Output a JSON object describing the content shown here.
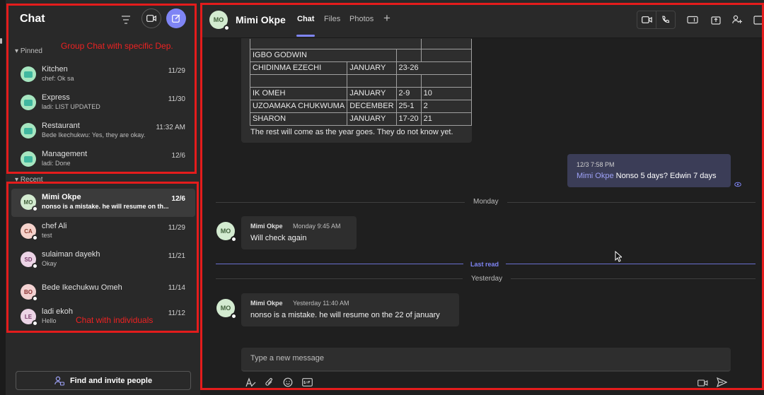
{
  "left": {
    "title": "Chat",
    "pinned_label": "Pinned",
    "recent_label": "Recent",
    "pinned": [
      {
        "name": "Kitchen",
        "preview": "chef: Ok sa",
        "time": "11/29"
      },
      {
        "name": "Express",
        "preview": "ladi: LIST UPDATED",
        "time": "11/30"
      },
      {
        "name": "Restaurant",
        "preview": "Bede Ikechukwu: Yes, they are okay.",
        "time": "11:32 AM"
      },
      {
        "name": "Management",
        "preview": "ladi: Done",
        "time": "12/6"
      }
    ],
    "recent": [
      {
        "initials": "MO",
        "name": "Mimi Okpe",
        "preview": "nonso is a mistake. he will resume on th...",
        "time": "12/6"
      },
      {
        "initials": "CA",
        "name": "chef Ali",
        "preview": "test",
        "time": "11/29"
      },
      {
        "initials": "SD",
        "name": "sulaiman dayekh",
        "preview": "Okay",
        "time": "11/21"
      },
      {
        "initials": "BO",
        "name": "Bede Ikechukwu Omeh",
        "preview": "",
        "time": "11/14"
      },
      {
        "initials": "LE",
        "name": "ladi ekoh",
        "preview": "Hello",
        "time": "11/12"
      }
    ],
    "invite_label": "Find and invite people"
  },
  "annotations": {
    "group": "Group Chat with specific Dep.",
    "individual": "Chat with individuals"
  },
  "header": {
    "initials": "MO",
    "name": "Mimi Okpe",
    "tabs": [
      "Chat",
      "Files",
      "Photos"
    ],
    "add_tab": "+"
  },
  "messages": {
    "table_rows": [
      [
        "IGBO GODWIN",
        "",
        "",
        ""
      ],
      [
        "CHIDINMA EZECHI",
        "JANUARY",
        "23-26",
        ""
      ],
      [
        "IK OMEH",
        "JANUARY",
        "2-9",
        "10"
      ],
      [
        "UZOAMAKA CHUKWUMA",
        "DECEMBER",
        "25-1",
        "2"
      ],
      [
        "SHARON",
        "JANUARY",
        "17-20",
        "21"
      ]
    ],
    "table_footer": "The rest will come as the year goes. They do not know yet.",
    "mine": {
      "time": "12/3 7:58 PM",
      "mention": "Mimi Okpe",
      "text": "Nonso 5 days? Edwin 7 days"
    },
    "divider_monday": "Monday",
    "msg1": {
      "sender": "Mimi Okpe",
      "time": "Monday 9:45 AM",
      "text": "Will check again"
    },
    "last_read": "Last read",
    "divider_yesterday": "Yesterday",
    "msg2": {
      "sender": "Mimi Okpe",
      "time": "Yesterday 11:40 AM",
      "text": "nonso is a mistake. he will resume on the 22 of january"
    }
  },
  "composer": {
    "placeholder": "Type a new message"
  },
  "colors": {
    "accent": "#7f85f5",
    "annotation": "#e41c1c"
  }
}
